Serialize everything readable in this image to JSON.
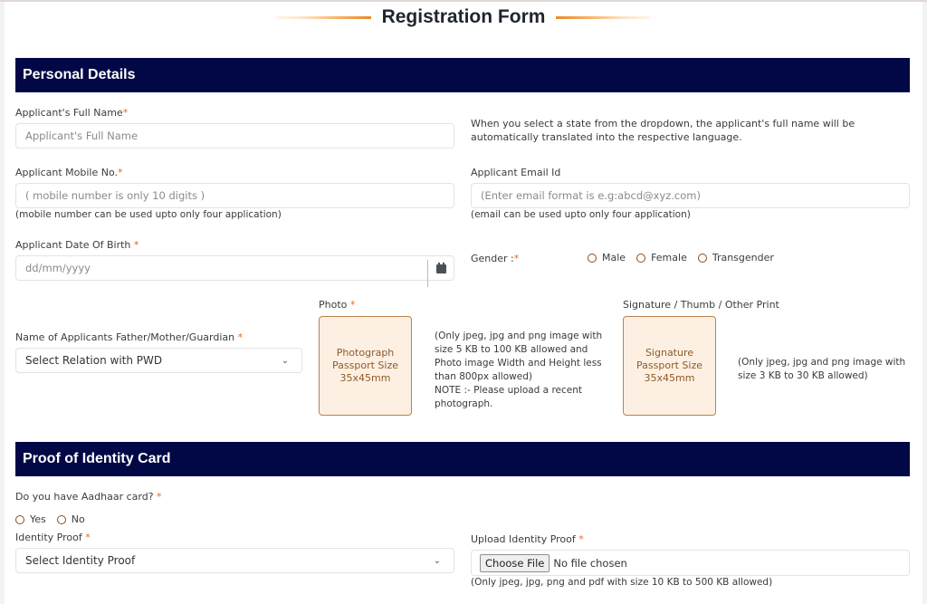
{
  "page": {
    "title": "Registration Form"
  },
  "personal_details": {
    "header": "Personal Details",
    "full_name": {
      "label": "Applicant's Full Name",
      "required": "*",
      "placeholder": "Applicant's Full Name",
      "value": ""
    },
    "translation_note": "When you select a state from the dropdown, the applicant's full name will be automatically translated into the respective language.",
    "mobile": {
      "label": "Applicant Mobile No.",
      "required": "*",
      "placeholder": "( mobile number is only 10 digits )",
      "value": "",
      "help": "(mobile number can be used upto only four application)"
    },
    "email": {
      "label": "Applicant Email Id",
      "placeholder": "(Enter email format is e.g:abcd@xyz.com)",
      "value": "",
      "help": "(email can be used upto only four application)"
    },
    "dob": {
      "label": "Applicant Date Of Birth ",
      "required": "*",
      "placeholder": "dd/mm/yyyy",
      "icon": "calendar-icon"
    },
    "gender": {
      "label": "Gender :",
      "required": "*",
      "options": [
        "Male",
        "Female",
        "Transgender"
      ],
      "selected": null
    },
    "guardian": {
      "label": "Name of Applicants Father/Mother/Guardian ",
      "required": "*",
      "selected": "Select Relation with PWD"
    },
    "photo": {
      "label": "Photo ",
      "required": "*",
      "box_lines": [
        "Photograph",
        "Passport Size",
        "35x45mm"
      ],
      "note_lines": [
        "(Only jpeg, jpg and png image with",
        "size 5 KB to 100 KB allowed and",
        "Photo image Width and Height less",
        "than 800px allowed)",
        "NOTE :- Please upload a recent",
        "photograph."
      ]
    },
    "signature": {
      "label": "Signature / Thumb / Other Print",
      "box_lines": [
        "Signature",
        "Passport Size",
        "35x45mm"
      ],
      "note_lines": [
        "(Only jpeg, jpg and png image with",
        "size 3 KB to 30 KB allowed)"
      ]
    }
  },
  "identity": {
    "header": "Proof of Identity Card",
    "aadhaar": {
      "label": "Do you have Aadhaar card? ",
      "required": "*",
      "options": [
        "Yes",
        "No"
      ],
      "selected": null
    },
    "identity_proof": {
      "label": "Identity Proof ",
      "required": "*",
      "selected": "Select Identity Proof"
    },
    "upload": {
      "label": "Upload Identity Proof ",
      "required": "*",
      "button": "Choose File",
      "status": "No file chosen",
      "help": "(Only jpeg, jpg, png and pdf with size 10 KB to 500 KB allowed)"
    }
  },
  "colors": {
    "section_header_bg": "#020846",
    "accent_orange": "#e98b2a",
    "required_star": "#e06b2a",
    "upload_box_bg": "#fdf0e2",
    "upload_box_border": "#b88250",
    "radio_border": "#8a4c1c"
  }
}
